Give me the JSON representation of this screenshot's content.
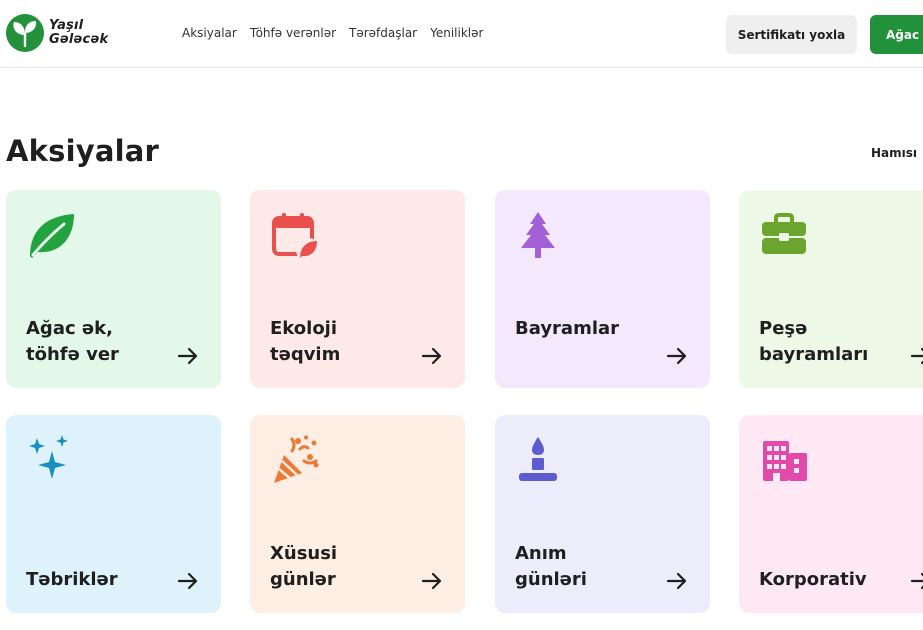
{
  "brand": {
    "line1": "Yaşıl",
    "line2": "Gələcək",
    "color": "#22913b"
  },
  "nav": [
    {
      "label": "Aksiyalar"
    },
    {
      "label": "Töhfə verənlər"
    },
    {
      "label": "Tərəfdaşlar"
    },
    {
      "label": "Yeniliklər"
    }
  ],
  "header_buttons": {
    "certificate": "Sertifikatı yoxla",
    "tree": "Ağac ək"
  },
  "section": {
    "title": "Aksiyalar",
    "see_all": "Hamısı"
  },
  "cards": [
    {
      "line1": "Ağac ək,",
      "line2": "töhfə ver",
      "icon": "leaf-icon",
      "bg": "#e3f8e8",
      "icon_color": "#22a33f"
    },
    {
      "line1": "Ekoloji",
      "line2": "təqvim",
      "icon": "calendar-leaf-icon",
      "bg": "#fde9e8",
      "icon_color": "#e9504c"
    },
    {
      "line1": "",
      "line2": "Bayramlar",
      "icon": "tree-icon",
      "bg": "#f4e8fc",
      "icon_color": "#a35fd6"
    },
    {
      "line1": "Peşə",
      "line2": "bayramları",
      "icon": "briefcase-icon",
      "bg": "#eef8e6",
      "icon_color": "#6ba52e"
    },
    {
      "line1": "",
      "line2": "Təbriklər",
      "icon": "sparkles-icon",
      "bg": "#ddf2fb",
      "icon_color": "#1a90c0"
    },
    {
      "line1": "Xüsusi",
      "line2": "günlər",
      "icon": "party-popper-icon",
      "bg": "#fdeee3",
      "icon_color": "#ec7a36"
    },
    {
      "line1": "Anım",
      "line2": "günləri",
      "icon": "candle-icon",
      "bg": "#ececfb",
      "icon_color": "#5d5bd0"
    },
    {
      "line1": "",
      "line2": "Korporativ",
      "icon": "buildings-icon",
      "bg": "#fde8f3",
      "icon_color": "#e24aa9"
    }
  ]
}
